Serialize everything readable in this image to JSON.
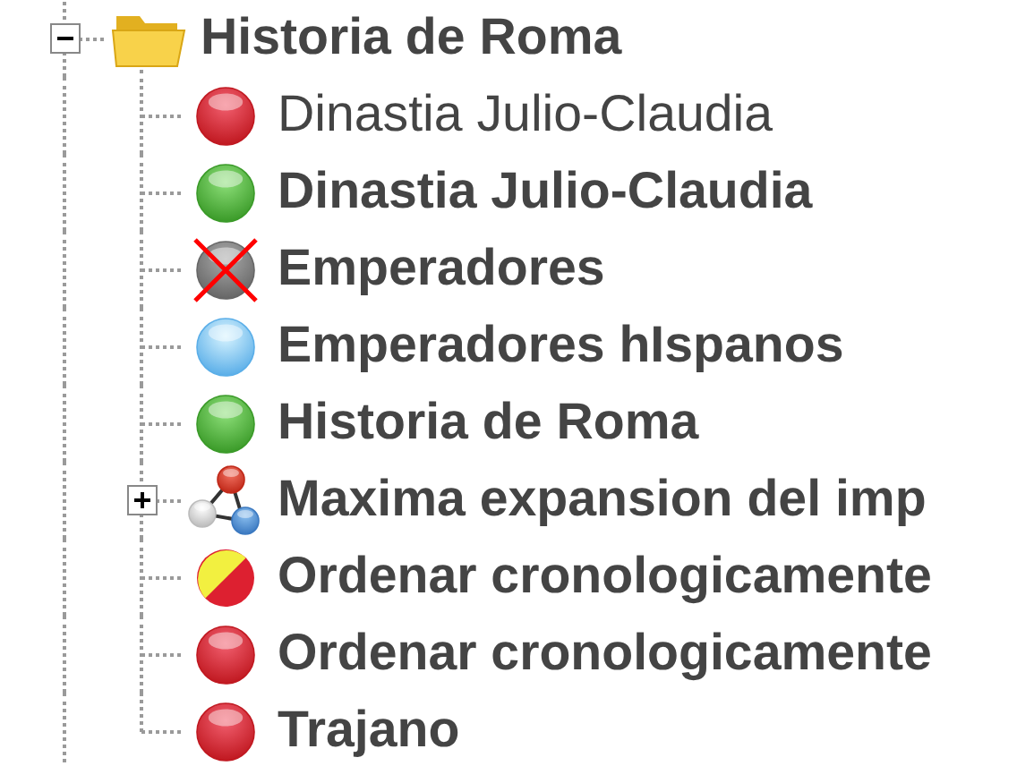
{
  "tree": {
    "label": "Historia de Roma",
    "kind": "folder",
    "bold": true,
    "expanded": true,
    "children": [
      {
        "label": "Dinastia Julio-Claudia",
        "kind": "red",
        "bold": false
      },
      {
        "label": "Dinastia Julio-Claudia",
        "kind": "green",
        "bold": true
      },
      {
        "label": "Emperadores",
        "kind": "excluded",
        "bold": true
      },
      {
        "label": "Emperadores hIspanos",
        "kind": "blue",
        "bold": true
      },
      {
        "label": "Historia de Roma",
        "kind": "green",
        "bold": true
      },
      {
        "label": "Maxima expansion del imp",
        "kind": "group",
        "bold": true,
        "expanded": false
      },
      {
        "label": "Ordenar cronologicamente",
        "kind": "mixed",
        "bold": true
      },
      {
        "label": "Ordenar cronologicamente",
        "kind": "red",
        "bold": true
      },
      {
        "label": "Trajano",
        "kind": "red",
        "bold": true
      }
    ]
  }
}
